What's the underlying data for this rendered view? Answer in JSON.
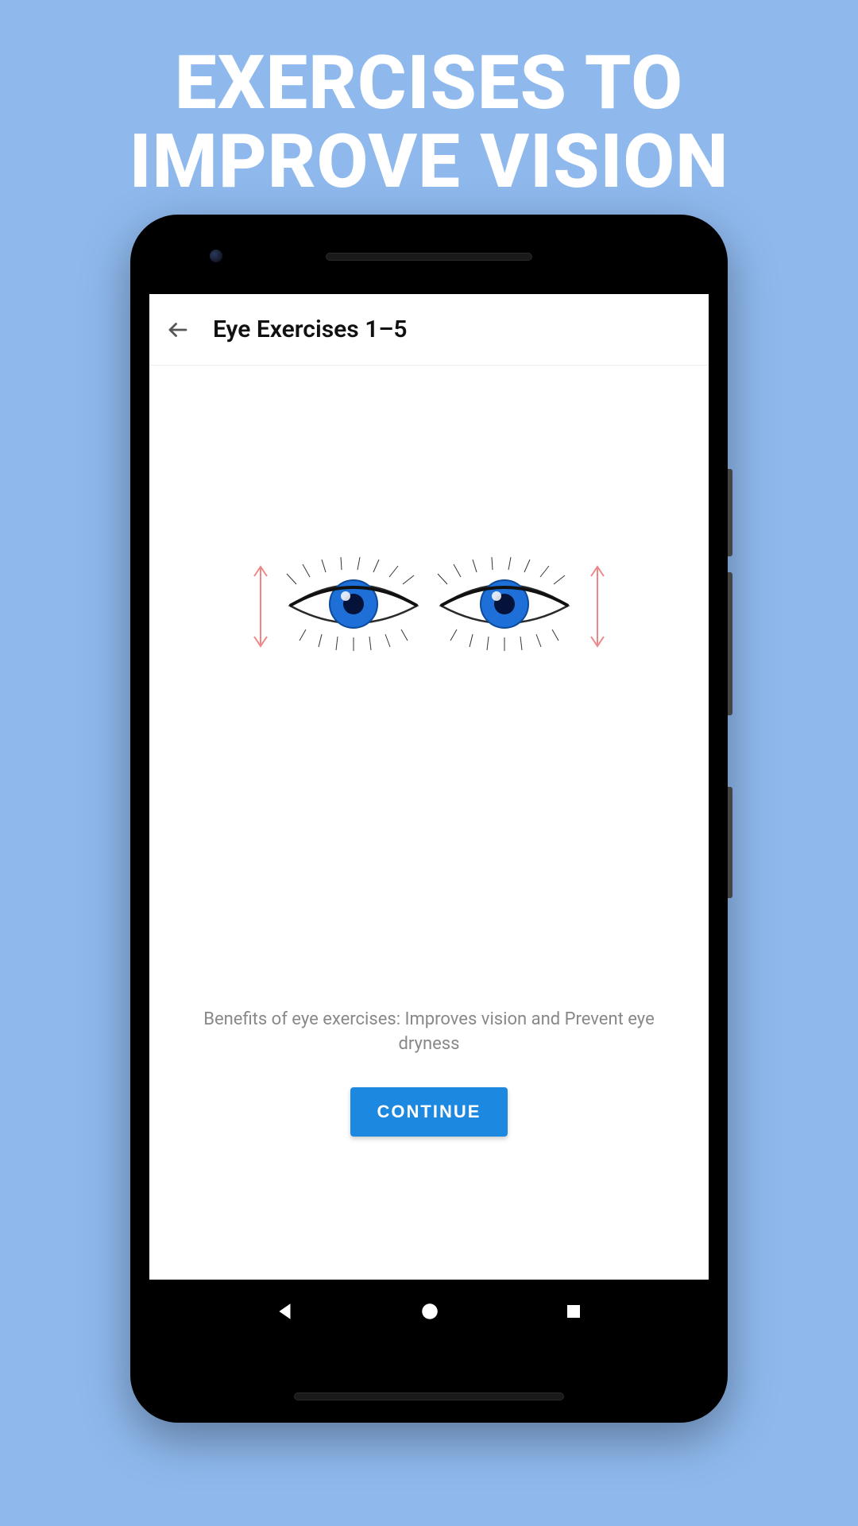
{
  "promo": {
    "title_line1": "EXERCISES TO",
    "title_line2": "IMPROVE VISION"
  },
  "app": {
    "header": {
      "back_icon": "back-arrow",
      "title": "Eye Exercises 1–5"
    },
    "content": {
      "illustration": "eyes-vertical-movement",
      "benefits_text": "Benefits of eye exercises: Improves vision and Prevent eye dryness",
      "continue_label": "CONTINUE"
    },
    "nav": {
      "back": "back-triangle",
      "home": "home-circle",
      "recent": "recent-square"
    }
  },
  "colors": {
    "background": "#8fb9ed",
    "button": "#1c88e0",
    "text_muted": "#888888"
  }
}
